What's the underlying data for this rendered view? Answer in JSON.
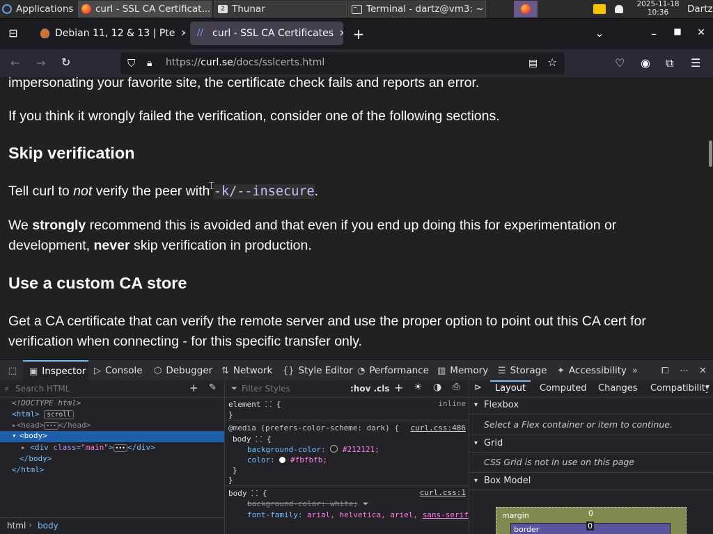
{
  "taskbar": {
    "applications": "Applications",
    "window1": "curl - SSL CA Certificat...",
    "window2": "Thunar",
    "window2_badge": "2",
    "window3": "Terminal - dartz@vm3: ~",
    "date": "2025-11-18",
    "time": "10:36",
    "user": "Dartz"
  },
  "tabs": [
    {
      "title": "Debian 11, 12 & 13 | Pte"
    },
    {
      "title": "curl - SSL CA Certificates"
    }
  ],
  "nav": {
    "url_prefix": "https://",
    "url_host": "curl.se",
    "url_path": "/docs/sslcerts.html"
  },
  "content": {
    "p0": "impersonating your favorite site, the certificate check fails and reports an error.",
    "p1": "If you think it wrongly failed the verification, consider one of the following sections.",
    "h_skip": "Skip verification",
    "p2_a": "Tell curl to ",
    "p2_em": "not",
    "p2_b": " verify the peer with ",
    "p2_code1": "-k",
    "p2_slash": "/",
    "p2_code2": "--insecure",
    "p2_end": ".",
    "p3_a": "We ",
    "p3_strong1": "strongly",
    "p3_b": " recommend this is avoided and that even if you end up doing this for experimentation or development, ",
    "p3_strong2": "never",
    "p3_c": " skip verification in production.",
    "h_custom": "Use a custom CA store",
    "p4": "Get a CA certificate that can verify the remote server and use the proper option to point out this CA cert for verification when connecting - for this specific transfer only."
  },
  "devtools": {
    "tabs": [
      "Inspector",
      "Console",
      "Debugger",
      "Network",
      "Style Editor",
      "Performance",
      "Memory",
      "Storage",
      "Accessibility"
    ],
    "search_placeholder": "Search HTML",
    "filter_placeholder": "Filter Styles",
    "hov_cls": ":hov .cls",
    "tree": {
      "doctype": "<!DOCTYPE html>",
      "html": "html",
      "scroll_badge": "scroll",
      "head": "head",
      "body": "body",
      "div_tag": "div",
      "div_attr": "class",
      "div_val": "\"main\"",
      "body_close": "</body>",
      "html_close": "</html>"
    },
    "breadcrumb": [
      "html",
      "body"
    ],
    "rules": {
      "element": "element",
      "inline": "inline",
      "media": "@media (prefers-color-scheme: dark) {",
      "media_src": "curl.css:486",
      "body": "body",
      "bg_prop": "background-color:",
      "bg_val": "#212121;",
      "color_prop": "color:",
      "color_val": "#fbfbfb;",
      "body2_src": "curl.css:1",
      "bg2": "background-color: white;",
      "ff_prop": "font-family:",
      "ff_val": "arial, helvetica, ariel, ",
      "ff_val2": "sans-serif",
      "ff_end": ";"
    },
    "layout_tabs": [
      "Layout",
      "Computed",
      "Changes",
      "Compatibility"
    ],
    "flexbox": "Flexbox",
    "flexbox_hint": "Select a Flex container or item to continue.",
    "grid": "Grid",
    "grid_hint": "CSS Grid is not in use on this page",
    "boxmodel": "Box Model",
    "margin_label": "margin",
    "margin_val": "0",
    "border_label": "border",
    "border_val": "0"
  },
  "colors": {
    "accent": "#75bfff",
    "page_bg": "#212121",
    "page_fg": "#fbfbfb",
    "selected_row": "#1f5ea8",
    "margin_box": "#818a4e",
    "border_box": "#5a55a0"
  }
}
